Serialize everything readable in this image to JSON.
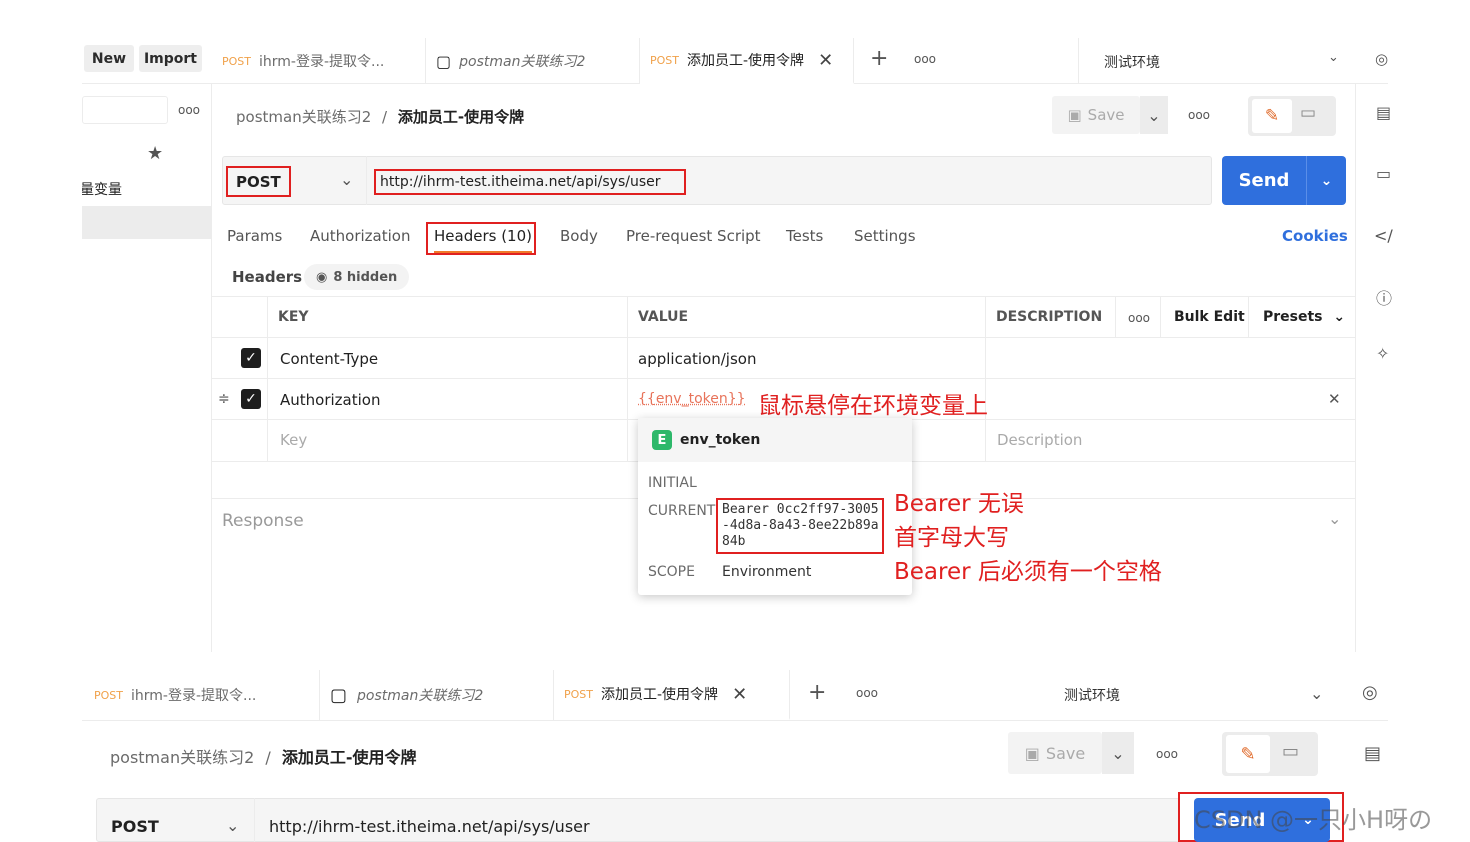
{
  "top": {
    "new_label": "New",
    "import_label": "Import",
    "tabs": [
      {
        "method": "POST",
        "label": "ihrm-登录-提取令..."
      },
      {
        "label": "postman关联练习2"
      },
      {
        "method": "POST",
        "label": "添加员工-使用令牌"
      }
    ],
    "add_tab": "+",
    "more": "ooo",
    "environment": "测试环境"
  },
  "sidebar": {
    "more": "ooo",
    "item_text": "量变量"
  },
  "breadcrumb": {
    "parent": "postman关联练习2",
    "sep": "/",
    "current": "添加员工-使用令牌"
  },
  "toolbar": {
    "save_label": "Save",
    "more": "ooo"
  },
  "request": {
    "method": "POST",
    "url": "http://ihrm-test.itheima.net/api/sys/user",
    "send_label": "Send"
  },
  "req_tabs": [
    "Params",
    "Authorization",
    "Headers (10)",
    "Body",
    "Pre-request Script",
    "Tests",
    "Settings"
  ],
  "cookies": "Cookies",
  "headers_section": {
    "title": "Headers",
    "hidden": "8 hidden"
  },
  "table": {
    "cols": [
      "KEY",
      "VALUE",
      "DESCRIPTION"
    ],
    "more": "ooo",
    "bulk_edit": "Bulk Edit",
    "presets": "Presets",
    "rows": [
      {
        "key": "Content-Type",
        "value": "application/json"
      },
      {
        "key": "Authorization",
        "value": "{{env_token}}"
      }
    ],
    "placeholder_key": "Key",
    "placeholder_desc": "Description"
  },
  "response_label": "Response",
  "tooltip": {
    "badge": "E",
    "name": "env_token",
    "initial_label": "INITIAL",
    "current_label": "CURRENT",
    "current_value": "Bearer 0cc2ff97-3005-4d8a-8a43-8ee22b89a84b",
    "scope_label": "SCOPE",
    "scope_value": "Environment"
  },
  "annotations": {
    "hover": "鼠标悬停在环境变量上",
    "line1": "Bearer 无误",
    "line2": "首字母大写",
    "line3": "Bearer 后必须有一个空格"
  },
  "bottom": {
    "tabs": [
      {
        "method": "POST",
        "label": "ihrm-登录-提取令..."
      },
      {
        "label": "postman关联练习2"
      },
      {
        "method": "POST",
        "label": "添加员工-使用令牌"
      }
    ],
    "environment": "测试环境",
    "breadcrumb_parent": "postman关联练习2",
    "breadcrumb_current": "添加员工-使用令牌",
    "save_label": "Save",
    "method": "POST",
    "url": "http://ihrm-test.itheima.net/api/sys/user",
    "send_label": "Send",
    "watermark": "CSDN @一只小H呀の"
  },
  "colors": {
    "accent": "#2f6fdd",
    "annotation": "#e02020",
    "method": "#f0a14a"
  }
}
